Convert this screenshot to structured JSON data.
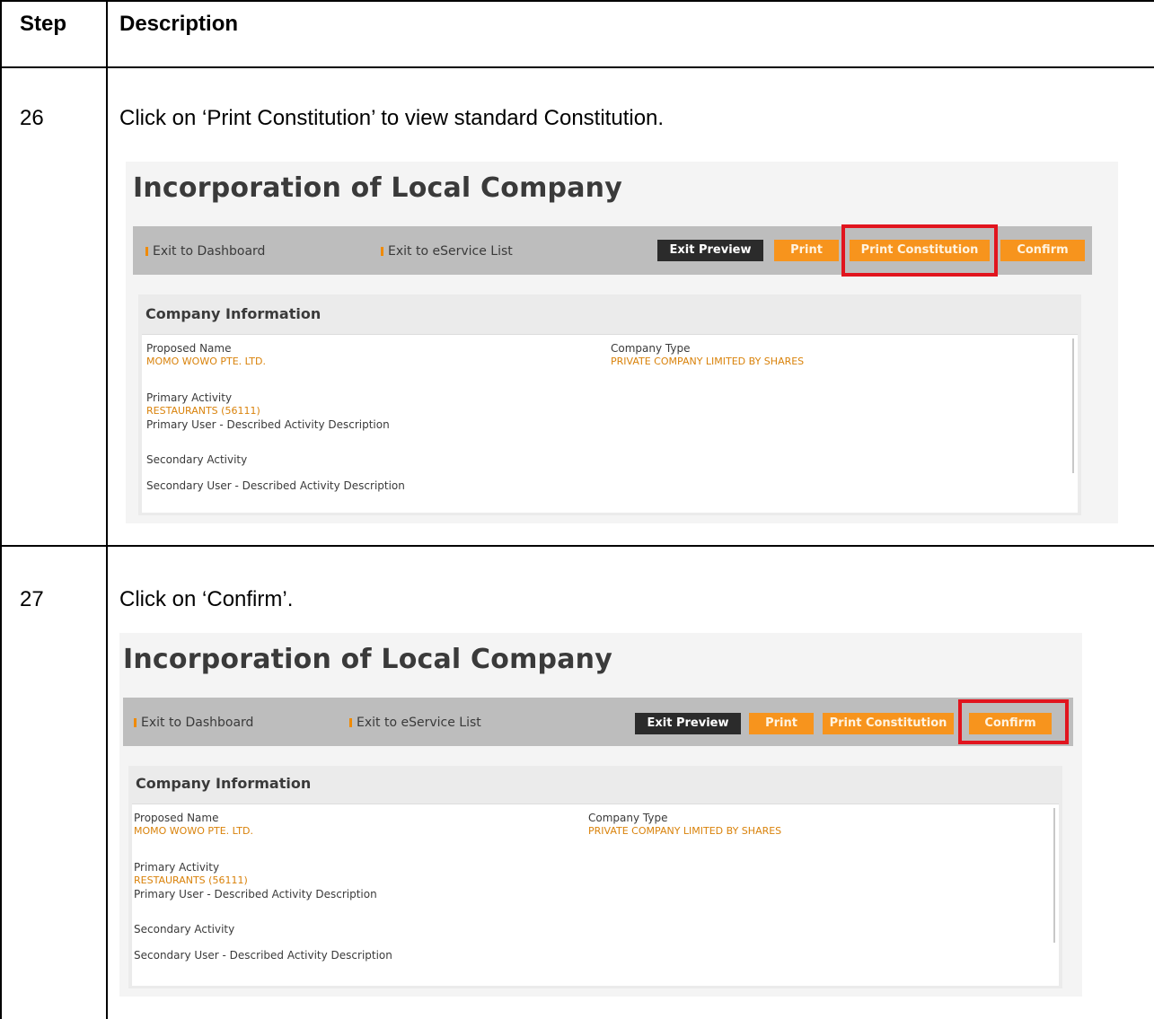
{
  "table": {
    "header": {
      "step": "Step",
      "description": "Description"
    },
    "rows": [
      {
        "step": "26",
        "instruction": "Click on ‘Print Constitution’  to view standard Constitution.",
        "screenshot": {
          "title": "Incorporation of Local Company",
          "nav": {
            "dashboard": "Exit to Dashboard",
            "eservice": "Exit to eService List"
          },
          "buttons": {
            "exit_preview": "Exit Preview",
            "print": "Print",
            "print_constitution": "Print Constitution",
            "confirm": "Confirm"
          },
          "highlighted": "Print Constitution",
          "section_title": "Company Information",
          "fields": {
            "proposed_name_label": "Proposed Name",
            "proposed_name_value": "MOMO WOWO PTE. LTD.",
            "company_type_label": "Company Type",
            "company_type_value": "PRIVATE COMPANY LIMITED BY SHARES",
            "primary_activity_label": "Primary Activity",
            "primary_activity_value": "RESTAURANTS (56111)",
            "primary_user_desc": "Primary User - Described Activity Description",
            "secondary_activity_label": "Secondary Activity",
            "secondary_user_desc": "Secondary User - Described Activity Description"
          }
        }
      },
      {
        "step": "27",
        "instruction": "Click on ‘Confirm’.",
        "screenshot": {
          "title": "Incorporation of Local Company",
          "nav": {
            "dashboard": "Exit to Dashboard",
            "eservice": "Exit to eService List"
          },
          "buttons": {
            "exit_preview": "Exit Preview",
            "print": "Print",
            "print_constitution": "Print Constitution",
            "confirm": "Confirm"
          },
          "highlighted": "Confirm",
          "section_title": "Company Information",
          "fields": {
            "proposed_name_label": "Proposed Name",
            "proposed_name_value": "MOMO WOWO PTE. LTD.",
            "company_type_label": "Company Type",
            "company_type_value": "PRIVATE COMPANY LIMITED BY SHARES",
            "primary_activity_label": "Primary Activity",
            "primary_activity_value": "RESTAURANTS (56111)",
            "primary_user_desc": "Primary User - Described Activity Description",
            "secondary_activity_label": "Secondary Activity",
            "secondary_user_desc": "Secondary User - Described Activity Description"
          }
        }
      }
    ]
  },
  "colors": {
    "button_orange": "#f7941d",
    "button_dark": "#2b2b2b",
    "highlight_red": "#e1141e",
    "value_orange": "#d9820a",
    "toolbar_grey": "#bdbdbd"
  },
  "icons": {
    "nav_bullet": "orange-bar-bullet"
  }
}
